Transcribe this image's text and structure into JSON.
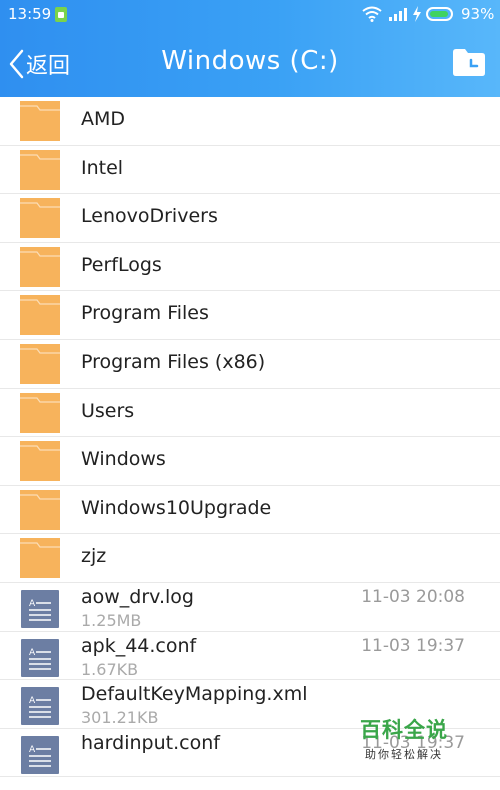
{
  "status_bar": {
    "time": "13:59",
    "battery_percent_label": "93%",
    "battery_level": 0.93,
    "icons": [
      "app-notification-icon",
      "wifi-icon",
      "signal-icon",
      "charging-bolt-icon",
      "battery-icon"
    ]
  },
  "header": {
    "back_label": "返回",
    "title": "Windows (C:)",
    "action_icon": "folder-clock-icon"
  },
  "folders": [
    {
      "name": "AMD"
    },
    {
      "name": "Intel"
    },
    {
      "name": "LenovoDrivers"
    },
    {
      "name": "PerfLogs"
    },
    {
      "name": "Program Files"
    },
    {
      "name": "Program Files (x86)"
    },
    {
      "name": "Users"
    },
    {
      "name": "Windows"
    },
    {
      "name": "Windows10Upgrade"
    },
    {
      "name": "zjz"
    }
  ],
  "files": [
    {
      "name": "aow_drv.log",
      "size": "1.25MB",
      "date": "11-03 20:08"
    },
    {
      "name": "apk_44.conf",
      "size": "1.67KB",
      "date": "11-03 19:37"
    },
    {
      "name": "DefaultKeyMapping.xml",
      "size": "301.21KB",
      "date": ""
    },
    {
      "name": "hardinput.conf",
      "size": "",
      "date": "11-03 19:37"
    }
  ],
  "watermark": {
    "main": "百科全说",
    "sub": "助你轻松解决"
  },
  "colors": {
    "header_start": "#2f8ff0",
    "header_end": "#58b7fa",
    "folder": "#f7b35c",
    "file_icon": "#6c7ea3"
  }
}
